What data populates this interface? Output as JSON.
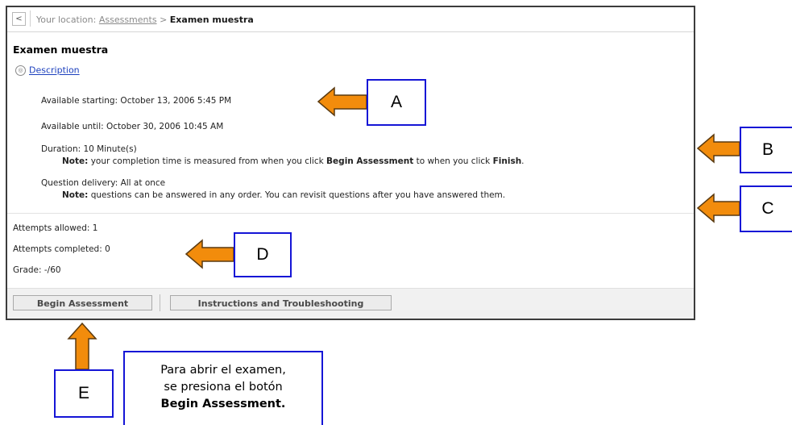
{
  "breadcrumb": {
    "back_symbol": "<",
    "prefix": "Your location:",
    "link": "Assessments",
    "separator": ">",
    "current": "Examen muestra"
  },
  "assessment": {
    "title": "Examen muestra",
    "description_link": "Description",
    "available_starting": "Available starting: October 13, 2006 5:45 PM",
    "available_until": "Available until: October 30, 2006 10:45 AM",
    "duration": "Duration: 10 Minute(s)",
    "duration_note_label": "Note:",
    "duration_note_1": "your completion time is measured from when you click",
    "duration_note_bold1": "Begin Assessment",
    "duration_note_2": "to when you click",
    "duration_note_bold2": "Finish",
    "duration_note_end": ".",
    "question_delivery": "Question delivery: All at once",
    "delivery_note_label": "Note:",
    "delivery_note": "questions can be answered in any order. You can revisit questions after you have answered them.",
    "attempts_allowed": "Attempts allowed: 1",
    "attempts_completed": "Attempts completed: 0",
    "grade": "Grade: -/60"
  },
  "buttons": {
    "begin": "Begin Assessment",
    "instructions": "Instructions and Troubleshooting"
  },
  "callouts": {
    "a": "A",
    "b": "B",
    "c": "C",
    "d": "D",
    "e": "E",
    "e_text_line1": "Para abrir el examen,",
    "e_text_line2": "se presiona el botón",
    "e_text_line3": "Begin Assessment."
  },
  "colors": {
    "arrow_fill": "#f28c0c",
    "arrow_stroke": "#5a3a10",
    "callout_border": "#1515d6",
    "link": "#1b3fbd"
  }
}
